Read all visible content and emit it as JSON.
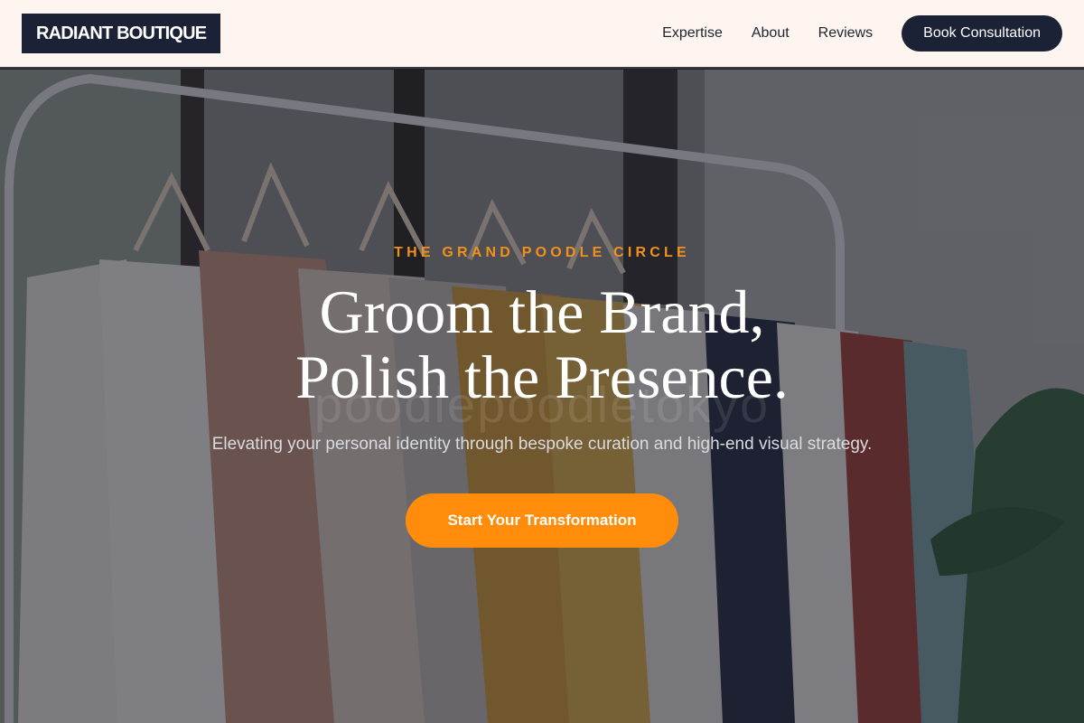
{
  "brand": {
    "logo_text": "RADIANT BOUTIQUE"
  },
  "nav": {
    "links": [
      {
        "label": "Expertise"
      },
      {
        "label": "About"
      },
      {
        "label": "Reviews"
      }
    ],
    "cta_label": "Book Consultation"
  },
  "hero": {
    "eyebrow": "THE GRAND POODLE CIRCLE",
    "headline_line1": "Groom the Brand,",
    "headline_line2": "Polish the Presence.",
    "watermark": "poodlepoodletokyo",
    "subheadline": "Elevating your personal identity through bespoke curation and high-end visual strategy.",
    "cta_label": "Start Your Transformation",
    "background_image": "clothing-rack-photo"
  },
  "colors": {
    "header_bg": "#fff5f0",
    "brand_navy": "#1b2236",
    "accent_orange": "#ff8c0a",
    "eyebrow_orange": "#f2901a",
    "hero_overlay": "rgba(20,22,34,0.52)"
  }
}
